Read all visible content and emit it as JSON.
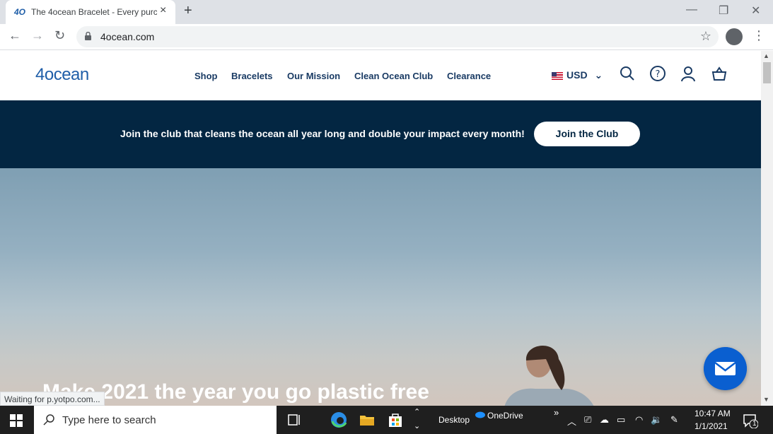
{
  "browser": {
    "tab_title": "The 4ocean Bracelet - Every purc",
    "tab_favicon": "4O",
    "new_tab": "+",
    "url": "4ocean.com",
    "status": "Waiting for p.yotpo.com..."
  },
  "site": {
    "logo": "4ocean",
    "nav": [
      "Shop",
      "Bracelets",
      "Our Mission",
      "Clean Ocean Club",
      "Clearance"
    ],
    "currency": "USD",
    "banner_text": "Join the club that cleans the ocean all year long and double your impact every month!",
    "banner_button": "Join the Club",
    "hero_heading": "Make 2021 the year you go plastic free"
  },
  "taskbar": {
    "search_placeholder": "Type here to search",
    "desktop": "Desktop",
    "onedrive": "OneDrive",
    "overflow": "»",
    "time": "10:47 AM",
    "date": "1/1/2021",
    "notifications": "1"
  },
  "colors": {
    "navy": "#032642",
    "nav_text": "#1a3b64",
    "logo": "#1f5ea8",
    "chat": "#0a5fd0"
  }
}
